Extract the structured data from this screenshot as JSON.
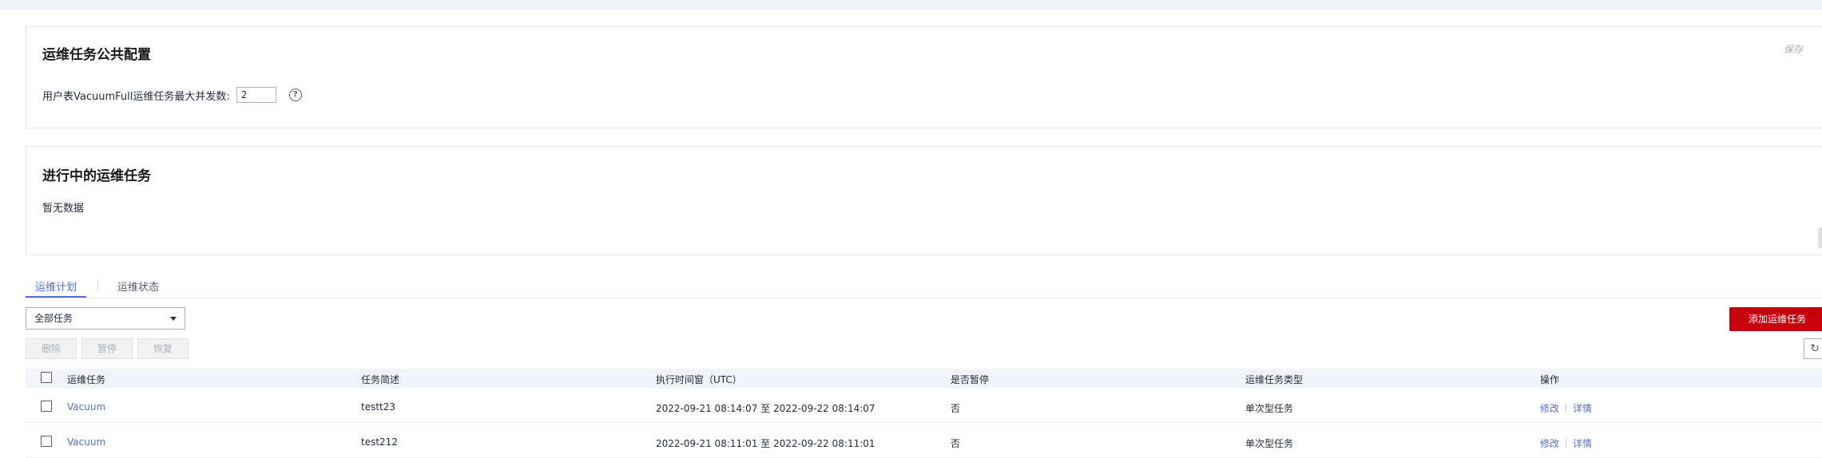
{
  "config_card": {
    "title": "运维任务公共配置",
    "save_label": "保存",
    "field_label": "用户表VacuumFull运维任务最大并发数:",
    "field_value": "2",
    "help_icon": "?"
  },
  "running_card": {
    "title": "进行中的运维任务",
    "empty_text": "暂无数据"
  },
  "tabs": [
    {
      "label": "运维计划",
      "active": true
    },
    {
      "label": "运维状态",
      "active": false
    }
  ],
  "filter": {
    "selected": "全部任务"
  },
  "toolbar": {
    "add_label": "添加运维任务",
    "delete_label": "删除",
    "pause_label": "暂停",
    "resume_label": "恢复",
    "refresh_icon": "↻"
  },
  "table": {
    "columns": [
      "运维任务",
      "任务简述",
      "执行时间窗（UTC）",
      "是否暂停",
      "运维任务类型",
      "操作"
    ],
    "rows": [
      {
        "task": "Vacuum",
        "desc": "testt23",
        "window": "2022-09-21 08:14:07 至 2022-09-22 08:14:07",
        "paused": "否",
        "type": "单次型任务",
        "edit": "修改",
        "detail": "详情"
      },
      {
        "task": "Vacuum",
        "desc": "test212",
        "window": "2022-09-21 08:11:01 至 2022-09-22 08:11:01",
        "paused": "否",
        "type": "单次型任务",
        "edit": "修改",
        "detail": "详情"
      }
    ]
  },
  "colors": {
    "primary_red": "#c7000b",
    "link_blue": "#526ecc",
    "header_bg": "#f0f3f8"
  }
}
